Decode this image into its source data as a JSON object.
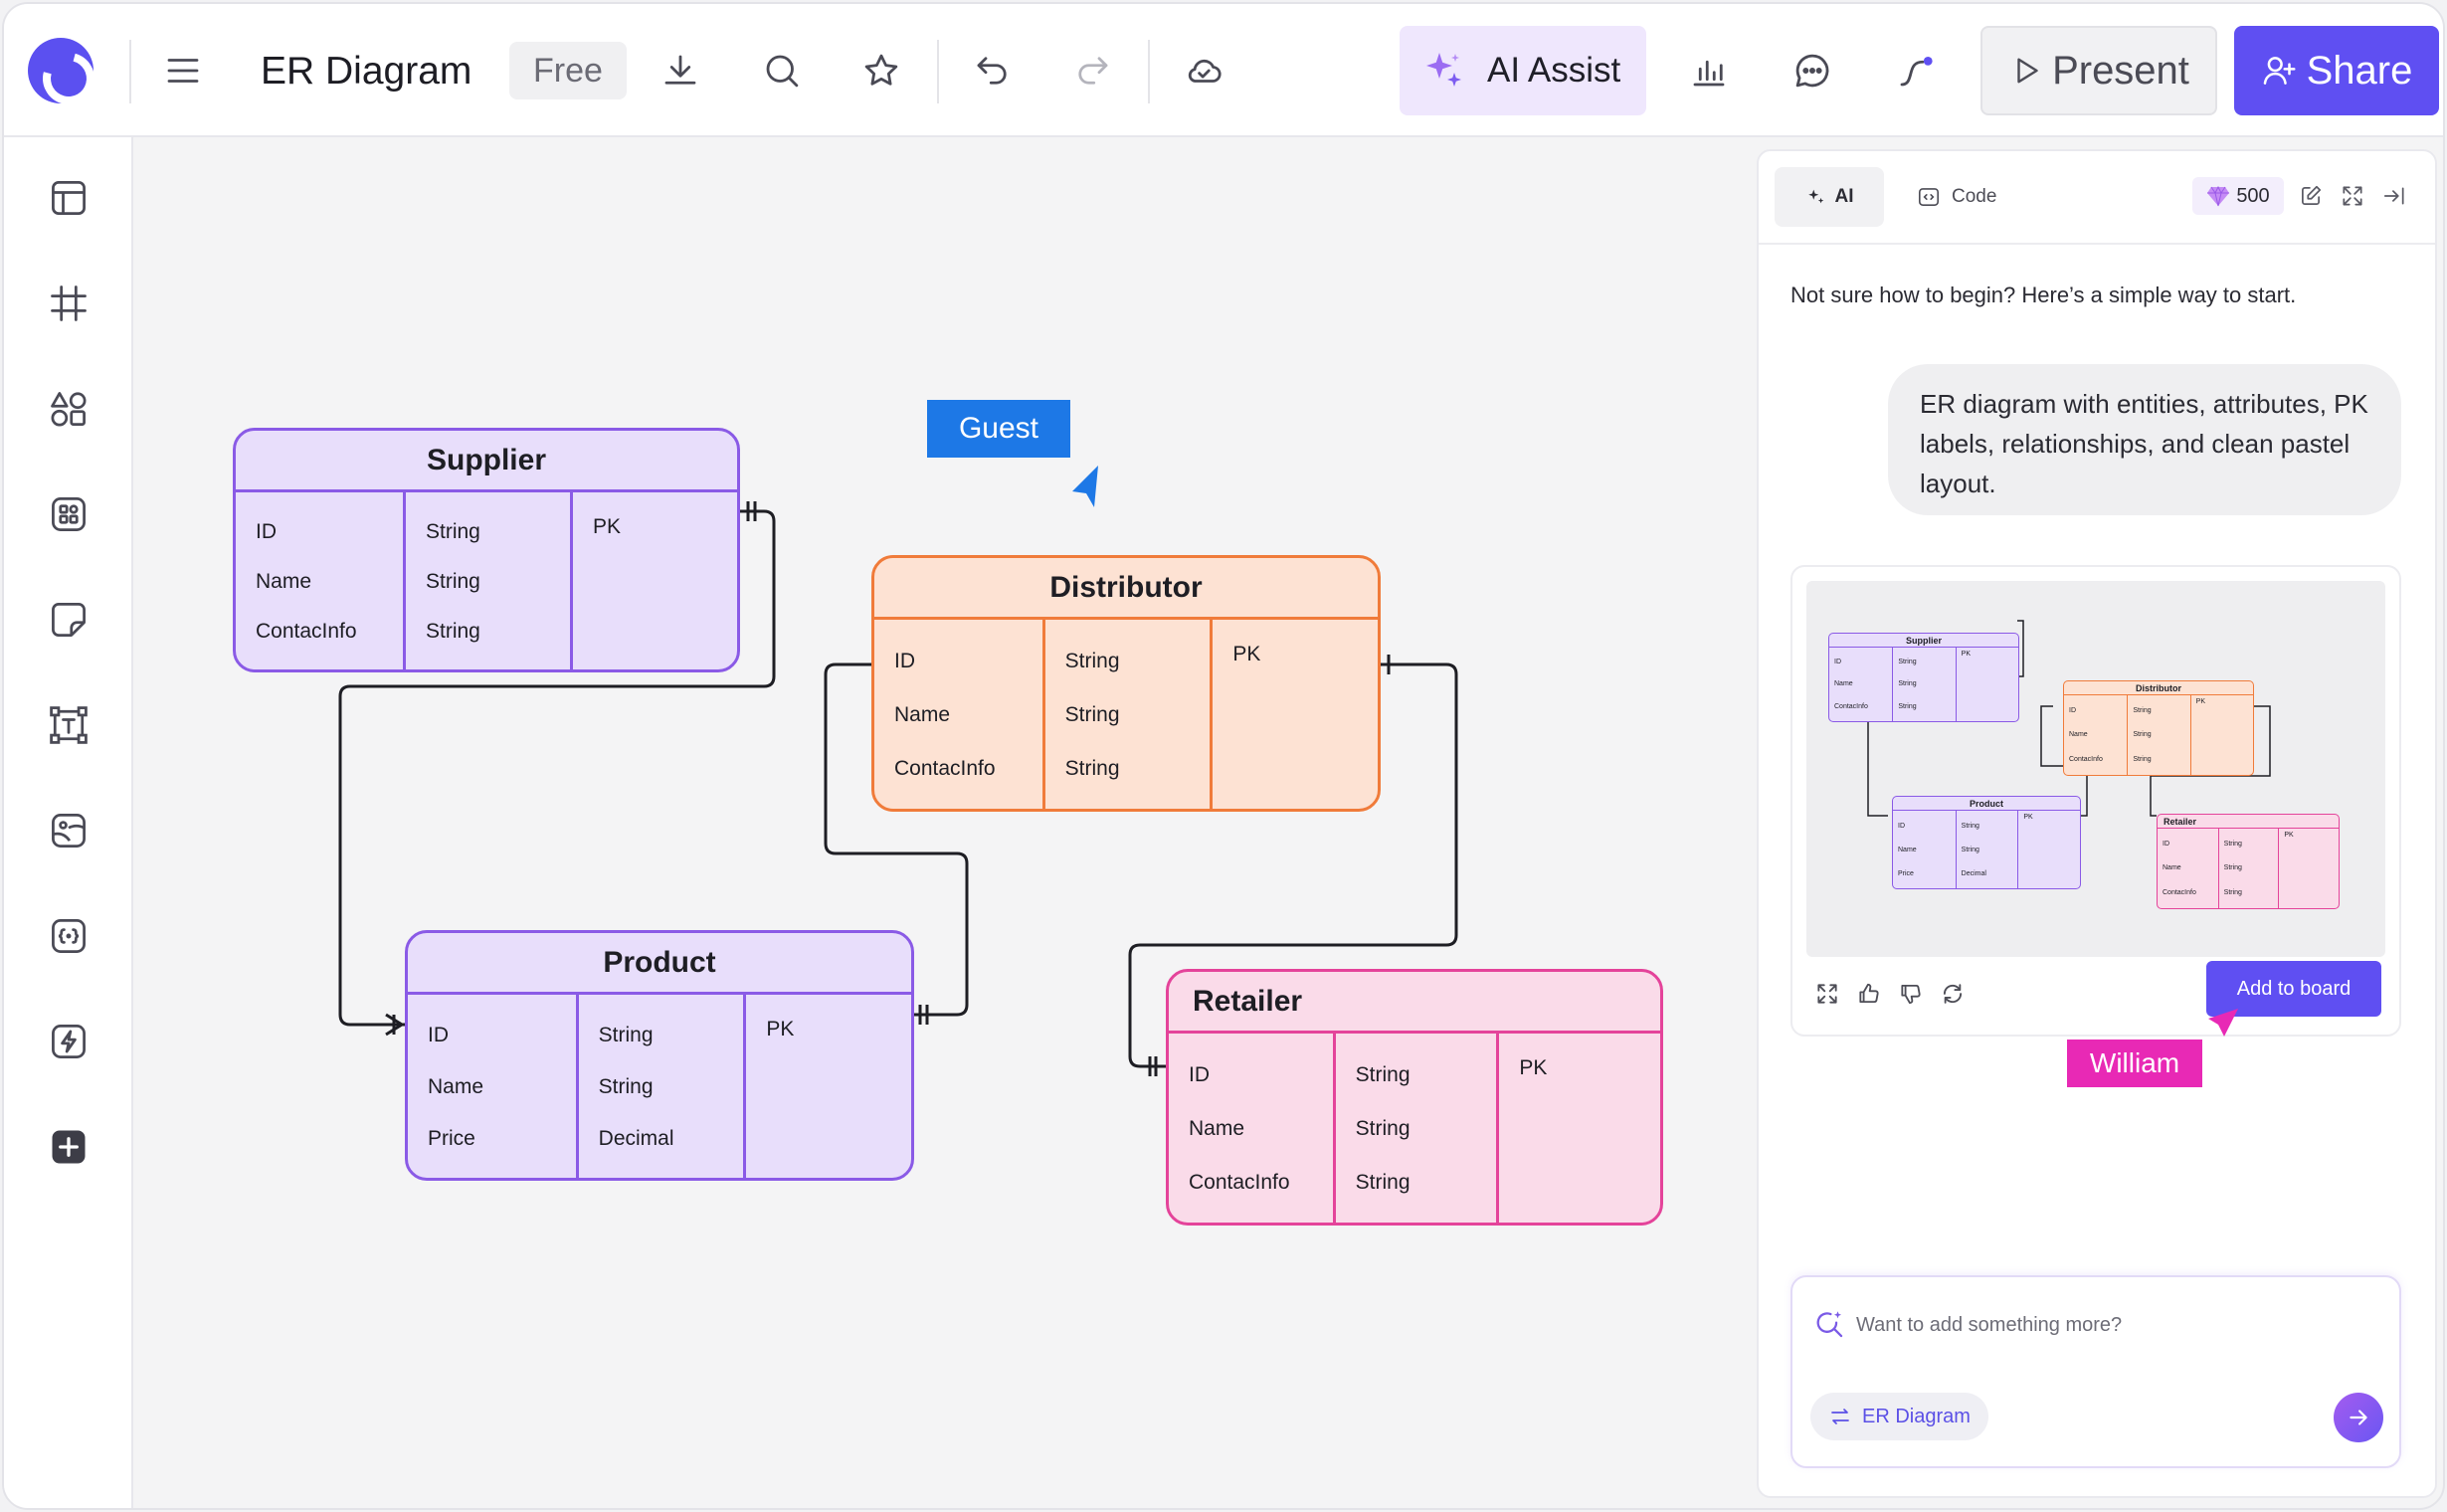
{
  "app": {
    "title": "ER Diagram",
    "plan_badge": "Free"
  },
  "toolbar": {
    "ai_assist_label": "AI Assist",
    "present_label": "Present",
    "share_label": "Share",
    "icons": [
      "menu-icon",
      "download-icon",
      "search-icon",
      "star-icon",
      "undo-icon",
      "redo-icon",
      "cloud-sync-icon",
      "sparkle-icon",
      "chart-icon",
      "comment-icon",
      "connector-icon",
      "play-icon",
      "add-user-icon"
    ]
  },
  "sidebar": {
    "items": [
      "layout-icon",
      "grid-icon",
      "shapes-icon",
      "components-icon",
      "sticky-note-icon",
      "text-box-icon",
      "image-icon",
      "code-block-icon",
      "lightning-icon",
      "plus-icon"
    ]
  },
  "diagram": {
    "entities": [
      {
        "name": "Supplier",
        "attributes": [
          "ID",
          "Name",
          "ContacInfo"
        ],
        "types": [
          "String",
          "String",
          "String"
        ],
        "keys": [
          "PK"
        ]
      },
      {
        "name": "Distributor",
        "attributes": [
          "ID",
          "Name",
          "ContacInfo"
        ],
        "types": [
          "String",
          "String",
          "String"
        ],
        "keys": [
          "PK"
        ]
      },
      {
        "name": "Product",
        "attributes": [
          "ID",
          "Name",
          "Price"
        ],
        "types": [
          "String",
          "String",
          "Decimal"
        ],
        "keys": [
          "PK"
        ]
      },
      {
        "name": "Retailer",
        "attributes": [
          "ID",
          "Name",
          "ContacInfo"
        ],
        "types": [
          "String",
          "String",
          "String"
        ],
        "keys": [
          "PK"
        ]
      }
    ],
    "colors": {
      "purple": "#8a5ae6",
      "orange": "#f07b3a",
      "pink": "#e4439a"
    }
  },
  "cursors": {
    "guest": "Guest",
    "william": "William"
  },
  "panel": {
    "tab_ai": "AI",
    "tab_code": "Code",
    "credits": "500",
    "intro": "Not sure how to begin? Here’s a simple way to start.",
    "user_message": "ER diagram with entities, attributes, PK labels, relationships, and clean pastel layout.",
    "add_to_board": "Add to board",
    "input_placeholder": "Want to add something more?",
    "context_chip": "ER Diagram"
  }
}
